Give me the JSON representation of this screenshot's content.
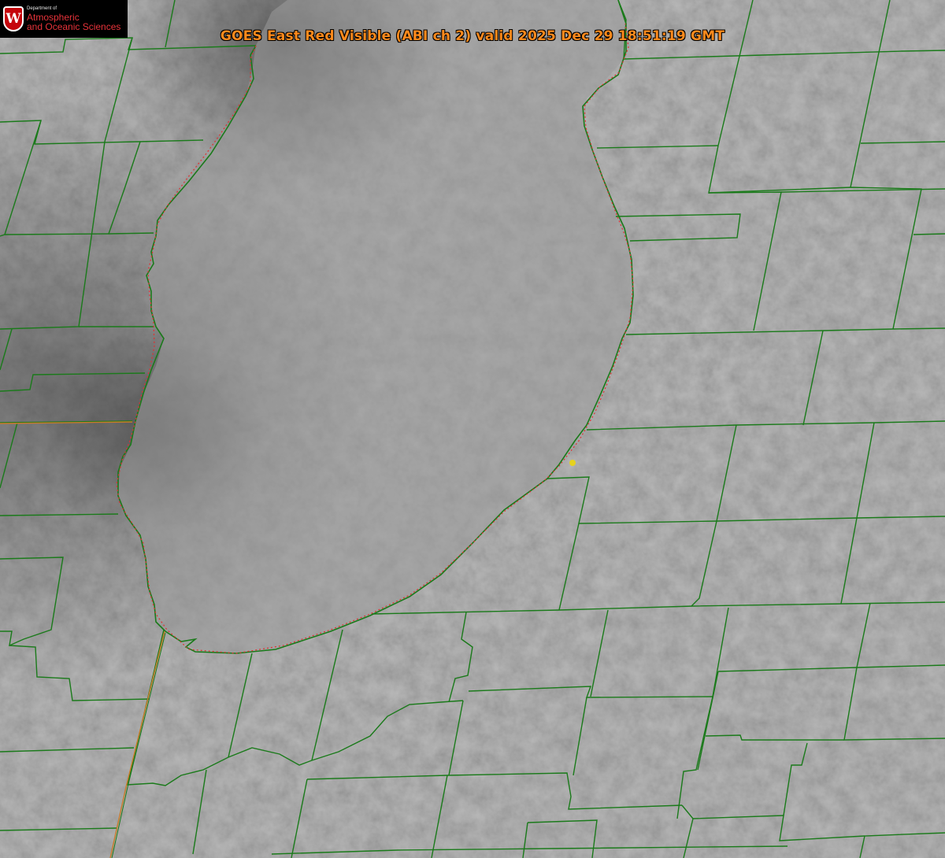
{
  "title": "GOES East Red Visible (ABI ch 2) valid 2025 Dec 29 18:51:19 GMT",
  "logo": {
    "department": "Department of",
    "line1": "Atmospheric",
    "line2": "and Oceanic Sciences",
    "crest_letter": "W"
  },
  "colors": {
    "county_lines": "#1a7a1a",
    "shoreline_dashed": "#e03030",
    "state_line": "#c87a28",
    "title_text": "#ff8a1c",
    "marker": "#e6d21e",
    "logo_red": "#c5050c"
  },
  "map": {
    "imagery": "grayscale visible satellite cloud field",
    "features": [
      "lake-shoreline",
      "county-boundaries",
      "state-boundary",
      "station-marker"
    ]
  }
}
